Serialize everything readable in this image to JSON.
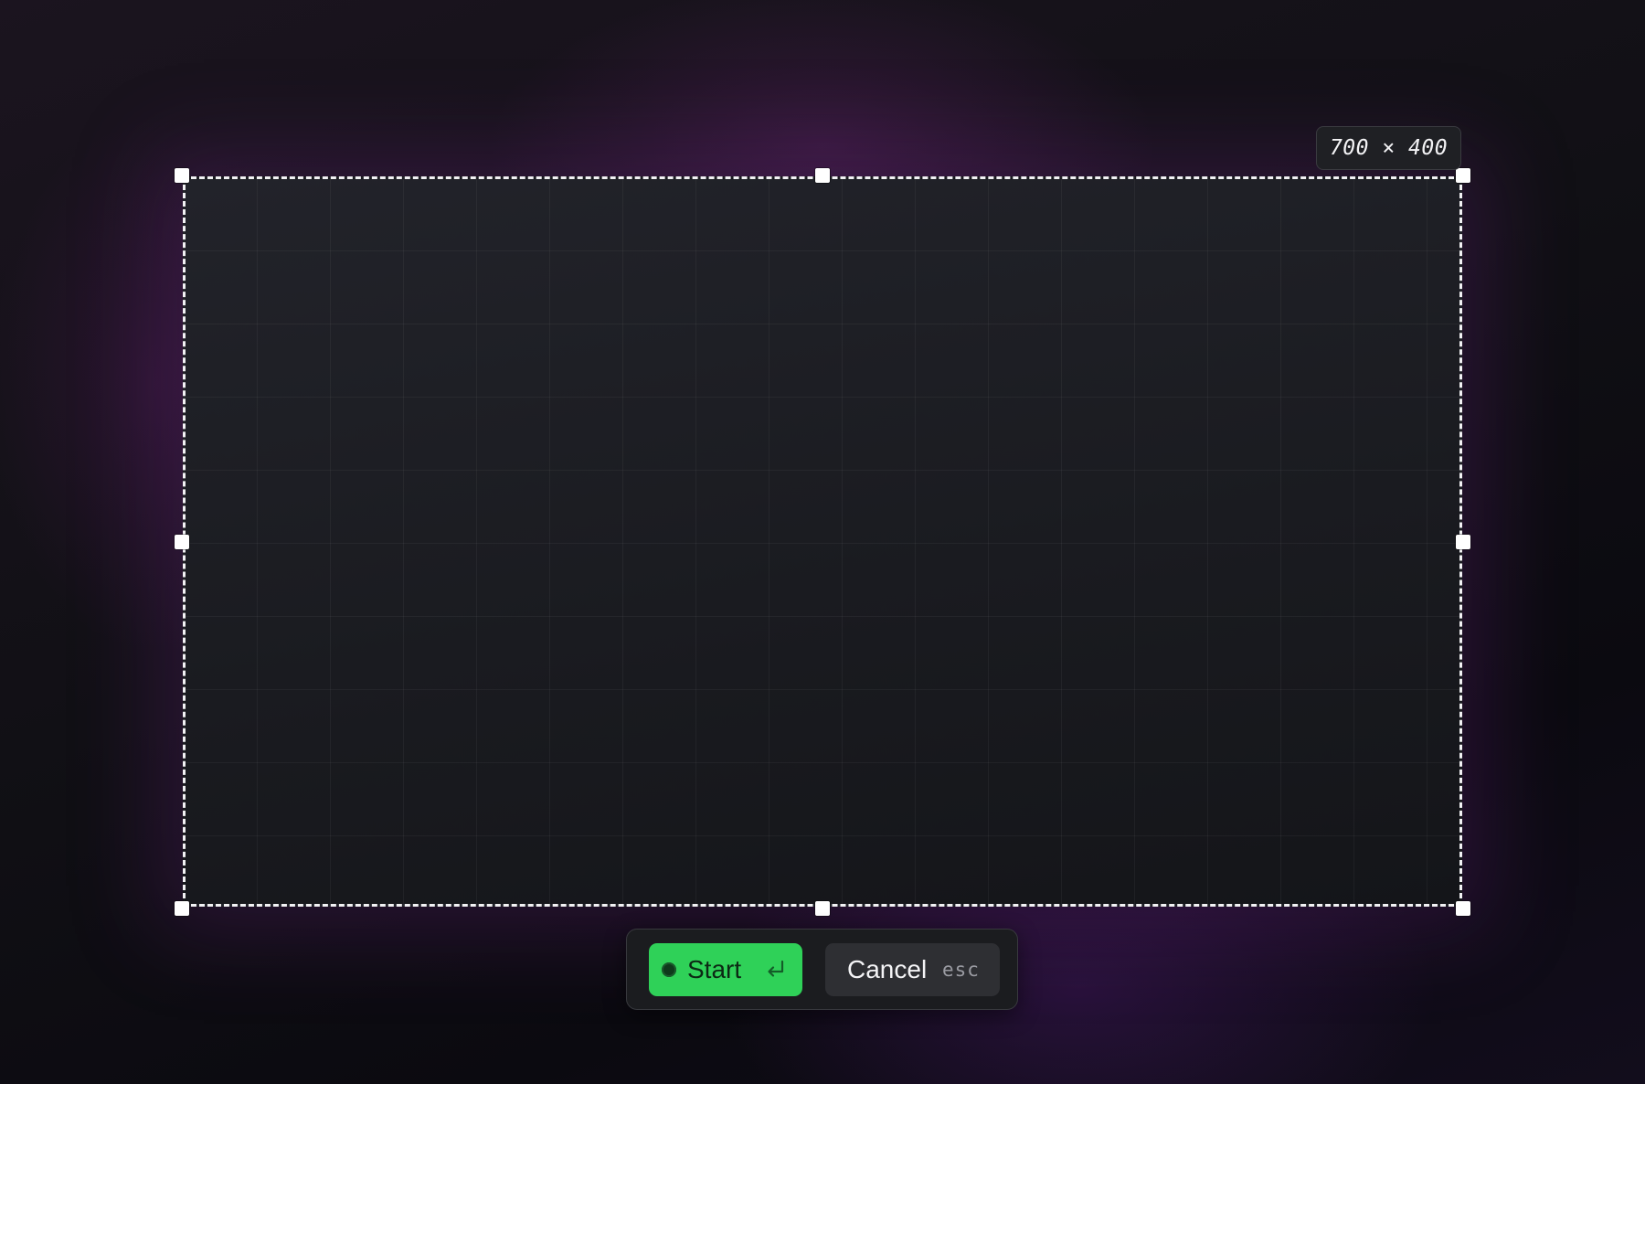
{
  "selection": {
    "size_label": "700 × 400"
  },
  "toolbar": {
    "start_label": "Start",
    "start_shortcut_icon": "return-arrow-icon",
    "cancel_label": "Cancel",
    "cancel_shortcut": "esc"
  },
  "colors": {
    "start_button": "#2fd158",
    "cancel_button": "#2e2f33",
    "selection_border": "#f2f2f4",
    "glow": "#7a2a90"
  }
}
